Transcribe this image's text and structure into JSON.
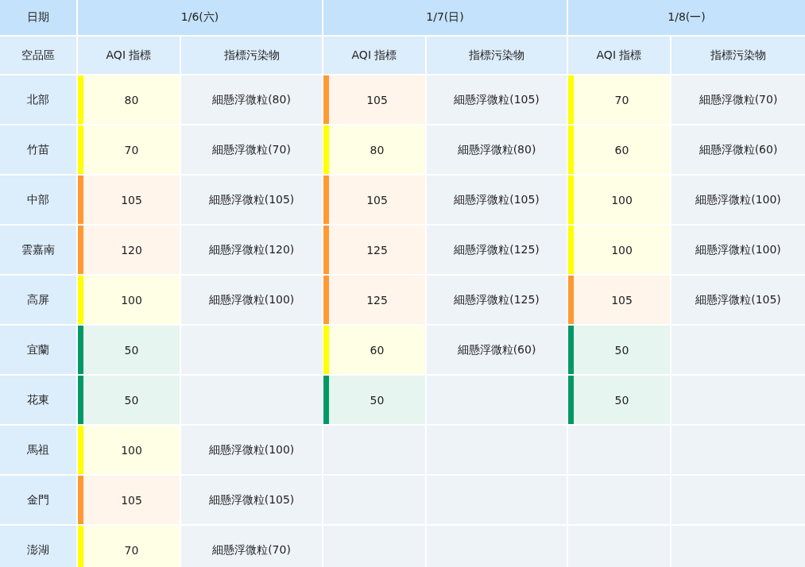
{
  "header": {
    "date_label": "日期",
    "region_label": "空品區",
    "dates": [
      {
        "label": "1/6(六)",
        "aqi_label": "AQI 指標",
        "pollutant_label": "指標污染物"
      },
      {
        "label": "1/7(日)",
        "aqi_label": "AQI 指標",
        "pollutant_label": "指標污染物"
      },
      {
        "label": "1/8(一)",
        "aqi_label": "AQI 指標",
        "pollutant_label": "指標污染物"
      }
    ]
  },
  "regions": [
    {
      "name": "北部",
      "readings": [
        {
          "aqi": "80",
          "color": "#ffff00",
          "pollutant": "細懸浮微粒(80)"
        },
        {
          "aqi": "105",
          "color": "#ff9933",
          "pollutant": "細懸浮微粒(105)"
        },
        {
          "aqi": "70",
          "color": "#ffff00",
          "pollutant": "細懸浮微粒(70)"
        }
      ]
    },
    {
      "name": "竹苗",
      "readings": [
        {
          "aqi": "70",
          "color": "#ffff00",
          "pollutant": "細懸浮微粒(70)"
        },
        {
          "aqi": "80",
          "color": "#ffff00",
          "pollutant": "細懸浮微粒(80)"
        },
        {
          "aqi": "60",
          "color": "#ffff00",
          "pollutant": "細懸浮微粒(60)"
        }
      ]
    },
    {
      "name": "中部",
      "readings": [
        {
          "aqi": "105",
          "color": "#ff9933",
          "pollutant": "細懸浮微粒(105)"
        },
        {
          "aqi": "105",
          "color": "#ff9933",
          "pollutant": "細懸浮微粒(105)"
        },
        {
          "aqi": "100",
          "color": "#ffff00",
          "pollutant": "細懸浮微粒(100)"
        }
      ]
    },
    {
      "name": "雲嘉南",
      "readings": [
        {
          "aqi": "120",
          "color": "#ff9933",
          "pollutant": "細懸浮微粒(120)"
        },
        {
          "aqi": "125",
          "color": "#ff9933",
          "pollutant": "細懸浮微粒(125)"
        },
        {
          "aqi": "100",
          "color": "#ffff00",
          "pollutant": "細懸浮微粒(100)"
        }
      ]
    },
    {
      "name": "高屏",
      "readings": [
        {
          "aqi": "100",
          "color": "#ffff00",
          "pollutant": "細懸浮微粒(100)"
        },
        {
          "aqi": "125",
          "color": "#ff9933",
          "pollutant": "細懸浮微粒(125)"
        },
        {
          "aqi": "105",
          "color": "#ff9933",
          "pollutant": "細懸浮微粒(105)"
        }
      ]
    },
    {
      "name": "宜蘭",
      "readings": [
        {
          "aqi": "50",
          "color": "#009966"
        },
        {
          "aqi": "60",
          "color": "#ffff00",
          "pollutant": "細懸浮微粒(60)"
        },
        {
          "aqi": "50",
          "color": "#009966"
        }
      ]
    },
    {
      "name": "花東",
      "readings": [
        {
          "aqi": "50",
          "color": "#009966"
        },
        {
          "aqi": "50",
          "color": "#009966"
        },
        {
          "aqi": "50",
          "color": "#009966"
        }
      ]
    },
    {
      "name": "馬祖",
      "readings": [
        {
          "aqi": "100",
          "color": "#ffff00",
          "pollutant": "細懸浮微粒(100)"
        }
      ]
    },
    {
      "name": "金門",
      "readings": [
        {
          "aqi": "105",
          "color": "#ff9933",
          "pollutant": "細懸浮微粒(105)"
        }
      ]
    },
    {
      "name": "澎湖",
      "readings": [
        {
          "aqi": "70",
          "color": "#ffff00",
          "pollutant": "細懸浮微粒(70)"
        }
      ]
    }
  ]
}
